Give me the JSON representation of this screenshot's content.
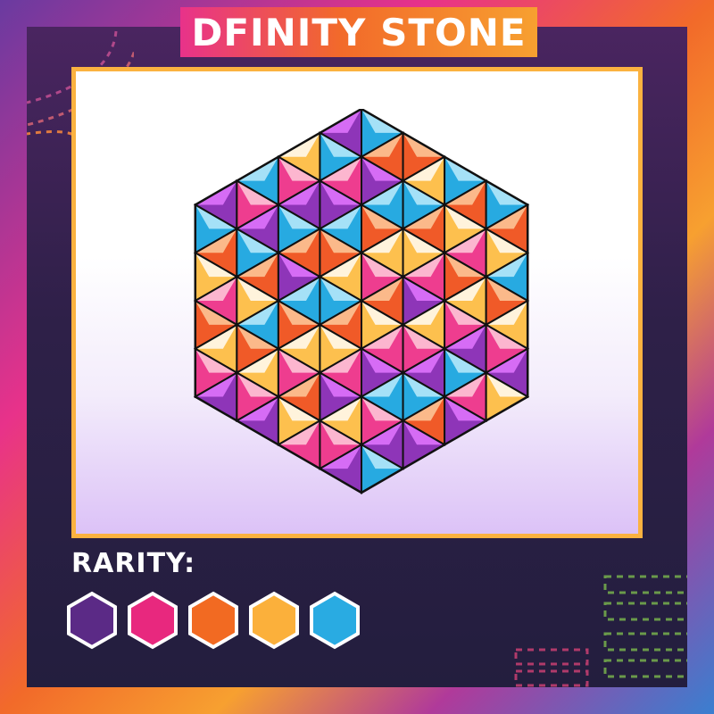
{
  "card": {
    "title": "DFINITY STONE",
    "rarity_label": "RARITY:",
    "gem_icon": "hexagon-gem-icon",
    "rarity_colors": [
      "#5b2a86",
      "#e8287e",
      "#f26a22",
      "#fbb03b",
      "#29abe2"
    ],
    "palette": {
      "purple_dark": "#8e35b8",
      "purple_light": "#d66cf5",
      "orange_dark": "#f05a28",
      "orange_light": "#fbb98a",
      "pink_dark": "#ee3d8f",
      "pink_light": "#fcb6cf",
      "blue_dark": "#27aae1",
      "blue_light": "#a5e1f7",
      "yellow_dark": "#fdc04e",
      "yellow_light": "#fff3dc",
      "frame": "#fbb240"
    }
  }
}
